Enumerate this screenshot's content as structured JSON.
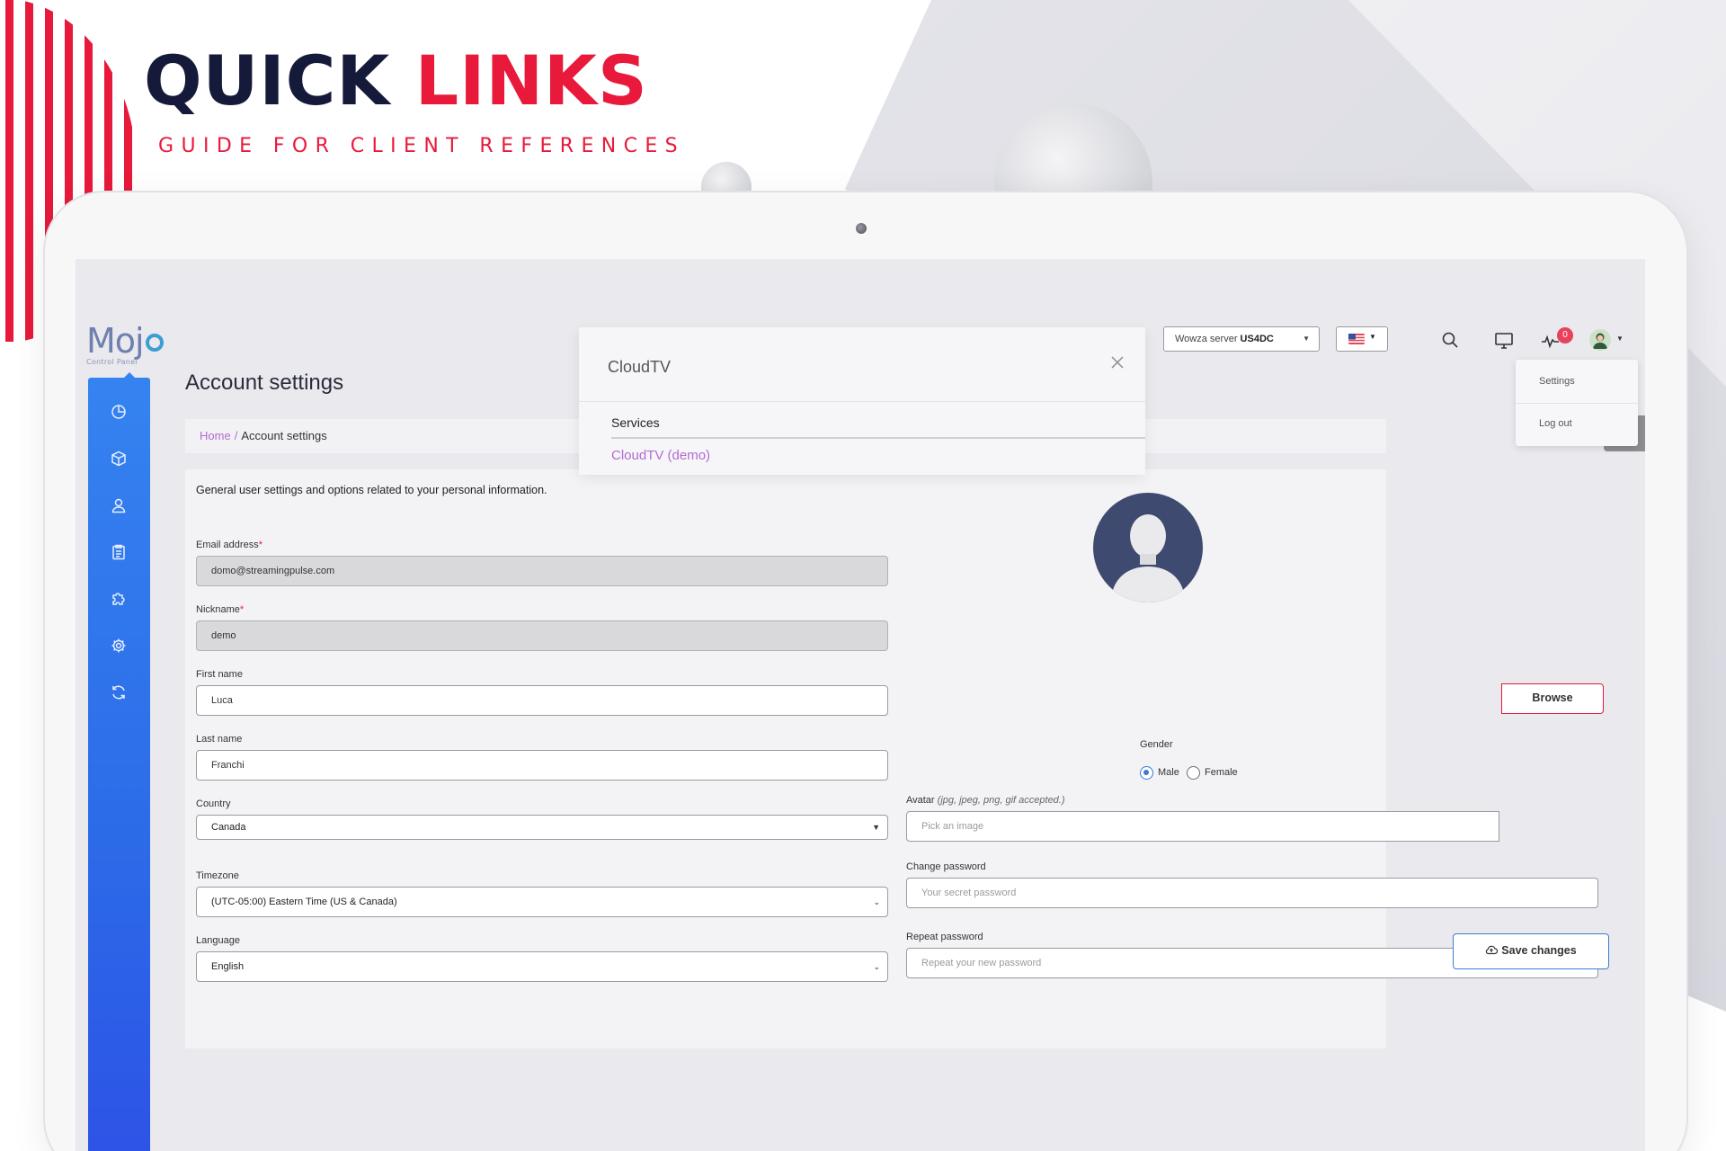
{
  "promo": {
    "title_word1": "QUICK",
    "title_word2": "LINKS",
    "subtitle": "GUIDE FOR CLIENT REFERENCES"
  },
  "app": {
    "logo_text": "Moj",
    "logo_subtext": "Control Panel",
    "page_title": "Account settings",
    "breadcrumb": {
      "home": "Home",
      "separator": "/",
      "current": "Account settings"
    },
    "description": "General user settings and options related to your personal information.",
    "sidebar_icons": [
      "dashboard-icon",
      "package-icon",
      "user-icon",
      "clipboard-icon",
      "puzzle-icon",
      "gear-icon",
      "refresh-icon"
    ]
  },
  "topbar": {
    "server_prefix": "Wowza server",
    "server_name": "US4DC",
    "language_flag": "us-flag-icon",
    "notification_count": "0",
    "user_menu": {
      "settings": "Settings",
      "logout": "Log out"
    }
  },
  "search_popup": {
    "query": "CloudTV",
    "section": "Services",
    "result": "CloudTV (demo)"
  },
  "form": {
    "email": {
      "label": "Email address",
      "required": "*",
      "value": "domo@streamingpulse.com"
    },
    "nickname": {
      "label": "Nickname",
      "required": "*",
      "value": "demo"
    },
    "first_name": {
      "label": "First name",
      "value": "Luca"
    },
    "last_name": {
      "label": "Last name",
      "value": "Franchi"
    },
    "country": {
      "label": "Country",
      "value": "Canada"
    },
    "timezone": {
      "label": "Timezone",
      "value": "(UTC-05:00) Eastern Time (US & Canada)"
    },
    "language": {
      "label": "Language",
      "value": "English"
    },
    "gender": {
      "label": "Gender",
      "options": [
        "Male",
        "Female"
      ],
      "selected": "Male"
    },
    "avatar": {
      "label": "Avatar",
      "hint": "(jpg, jpeg, png, gif accepted.)",
      "placeholder": "Pick an image",
      "browse_label": "Browse"
    },
    "change_password": {
      "label": "Change password",
      "placeholder": "Your secret password"
    },
    "repeat_password": {
      "label": "Repeat password",
      "placeholder": "Repeat your new password"
    },
    "save_label": "Save changes"
  },
  "colors": {
    "brand_red": "#e8193b",
    "brand_navy": "#151a3a",
    "sidebar_blue": "#2c6ae8",
    "link_purple": "#b36ad0",
    "primary_blue": "#3a7bd5"
  }
}
